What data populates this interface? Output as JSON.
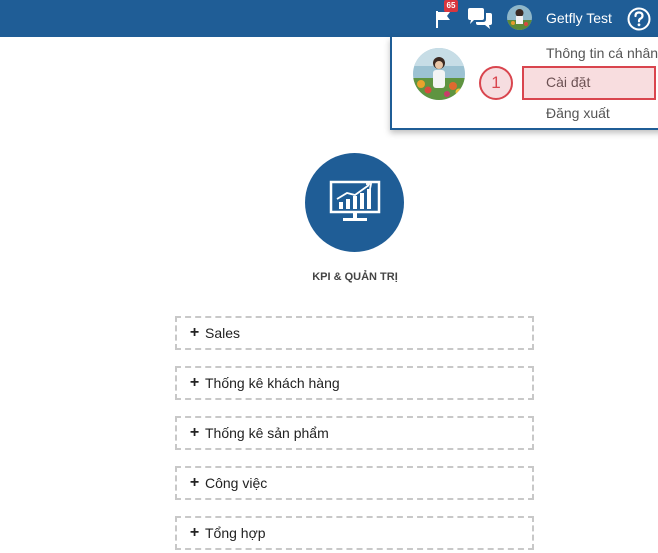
{
  "header": {
    "notification_count": "65",
    "username": "Getfly Test",
    "icons": [
      "flag-icon",
      "chat-icon",
      "help-icon"
    ]
  },
  "user_menu": {
    "items": [
      {
        "label": "Thông tin cá nhân"
      },
      {
        "label": "Cài đặt"
      },
      {
        "label": "Đăng xuất"
      }
    ],
    "step_marker": "1"
  },
  "main": {
    "section_title": "KPI & QUẢN TRỊ",
    "menu_items": [
      {
        "label": "Sales"
      },
      {
        "label": "Thống kê khách hàng"
      },
      {
        "label": "Thống kê sản phẩm"
      },
      {
        "label": "Công việc"
      },
      {
        "label": "Tổng hợp"
      }
    ]
  },
  "colors": {
    "header_bg": "#1f5d96",
    "badge": "#d9363e",
    "highlight": "#d9454e"
  }
}
